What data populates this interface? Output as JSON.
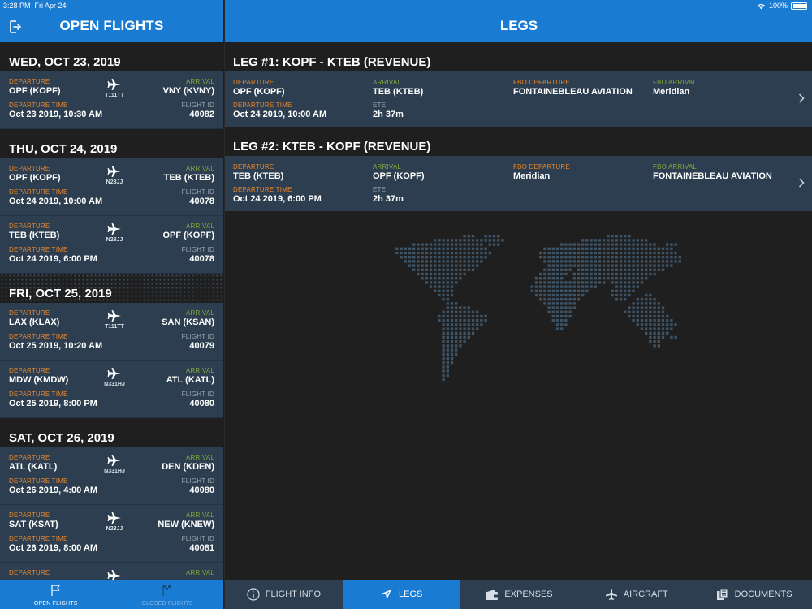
{
  "status": {
    "time": "3:28 PM",
    "date": "Fri Apr 24",
    "battery": "100%"
  },
  "left": {
    "title": "OPEN FLIGHTS",
    "groups": [
      {
        "date": "WED, OCT 23, 2019",
        "flights": [
          {
            "dep_label": "DEPARTURE",
            "dep": "OPF (KOPF)",
            "arr_label": "ARRIVAL",
            "arr": "VNY (KVNY)",
            "tail": "T111TT",
            "time_label": "DEPARTURE TIME",
            "time": "Oct 23 2019, 10:30 AM",
            "id_label": "FLIGHT ID",
            "id": "40082"
          }
        ]
      },
      {
        "date": "THU, OCT 24, 2019",
        "flights": [
          {
            "dep_label": "DEPARTURE",
            "dep": "OPF (KOPF)",
            "arr_label": "ARRIVAL",
            "arr": "TEB (KTEB)",
            "tail": "N23JJ",
            "time_label": "DEPARTURE TIME",
            "time": "Oct 24 2019, 10:00 AM",
            "id_label": "FLIGHT ID",
            "id": "40078"
          },
          {
            "dep_label": "DEPARTURE",
            "dep": "TEB (KTEB)",
            "arr_label": "ARRIVAL",
            "arr": "OPF (KOPF)",
            "tail": "N23JJ",
            "time_label": "DEPARTURE TIME",
            "time": "Oct 24 2019, 6:00 PM",
            "id_label": "FLIGHT ID",
            "id": "40078"
          }
        ]
      },
      {
        "date": "FRI, OCT 25, 2019",
        "flights": [
          {
            "dep_label": "DEPARTURE",
            "dep": "LAX (KLAX)",
            "arr_label": "ARRIVAL",
            "arr": "SAN (KSAN)",
            "tail": "T111TT",
            "time_label": "DEPARTURE TIME",
            "time": "Oct 25 2019, 10:20 AM",
            "id_label": "FLIGHT ID",
            "id": "40079"
          },
          {
            "dep_label": "DEPARTURE",
            "dep": "MDW (KMDW)",
            "arr_label": "ARRIVAL",
            "arr": "ATL (KATL)",
            "tail": "N331HJ",
            "time_label": "DEPARTURE TIME",
            "time": "Oct 25 2019, 8:00 PM",
            "id_label": "FLIGHT ID",
            "id": "40080"
          }
        ]
      },
      {
        "date": "SAT, OCT 26, 2019",
        "flights": [
          {
            "dep_label": "DEPARTURE",
            "dep": "ATL (KATL)",
            "arr_label": "ARRIVAL",
            "arr": "DEN (KDEN)",
            "tail": "N331HJ",
            "time_label": "DEPARTURE TIME",
            "time": "Oct 26 2019, 4:00 AM",
            "id_label": "FLIGHT ID",
            "id": "40080"
          },
          {
            "dep_label": "DEPARTURE",
            "dep": "SAT (KSAT)",
            "arr_label": "ARRIVAL",
            "arr": "NEW (KNEW)",
            "tail": "N23JJ",
            "time_label": "DEPARTURE TIME",
            "time": "Oct 26 2019, 8:00 AM",
            "id_label": "FLIGHT ID",
            "id": "40081"
          },
          {
            "dep_label": "DEPARTURE",
            "dep": "",
            "arr_label": "ARRIVAL",
            "arr": "",
            "tail": "",
            "time_label": "",
            "time": "",
            "id_label": "",
            "id": ""
          }
        ]
      }
    ],
    "tabs": {
      "open": "OPEN FLIGHTS",
      "closed": "CLOSED FLIGHTS"
    }
  },
  "right": {
    "title": "LEGS",
    "legs": [
      {
        "title": "LEG #1: KOPF - KTEB (REVENUE)",
        "dep_label": "DEPARTURE",
        "dep": "OPF (KOPF)",
        "arr_label": "ARRIVAL",
        "arr": "TEB (KTEB)",
        "fbo_dep_label": "FBO DEPARTURE",
        "fbo_dep": "FONTAINEBLEAU AVIATION",
        "fbo_arr_label": "FBO ARRIVAL",
        "fbo_arr": "Meridian",
        "time_label": "DEPARTURE TIME",
        "time": "Oct 24 2019, 10:00 AM",
        "ete_label": "ETE",
        "ete": "2h 37m"
      },
      {
        "title": "LEG #2: KTEB - KOPF (REVENUE)",
        "dep_label": "DEPARTURE",
        "dep": "TEB (KTEB)",
        "arr_label": "ARRIVAL",
        "arr": "OPF (KOPF)",
        "fbo_dep_label": "FBO DEPARTURE",
        "fbo_dep": "Meridian",
        "fbo_arr_label": "FBO ARRIVAL",
        "fbo_arr": "FONTAINEBLEAU AVIATION",
        "time_label": "DEPARTURE TIME",
        "time": "Oct 24 2019, 6:00 PM",
        "ete_label": "ETE",
        "ete": "2h 37m"
      }
    ],
    "tabs": [
      {
        "label": "FLIGHT INFO",
        "icon": "info-icon"
      },
      {
        "label": "LEGS",
        "icon": "plane-icon"
      },
      {
        "label": "EXPENSES",
        "icon": "wallet-icon"
      },
      {
        "label": "AIRCRAFT",
        "icon": "aircraft-icon"
      },
      {
        "label": "DOCUMENTS",
        "icon": "documents-icon"
      }
    ]
  },
  "colors": {
    "accent": "#1a7bd2",
    "panel": "#2c3e4f",
    "departure": "#e9862b",
    "arrival": "#7ea83c"
  }
}
